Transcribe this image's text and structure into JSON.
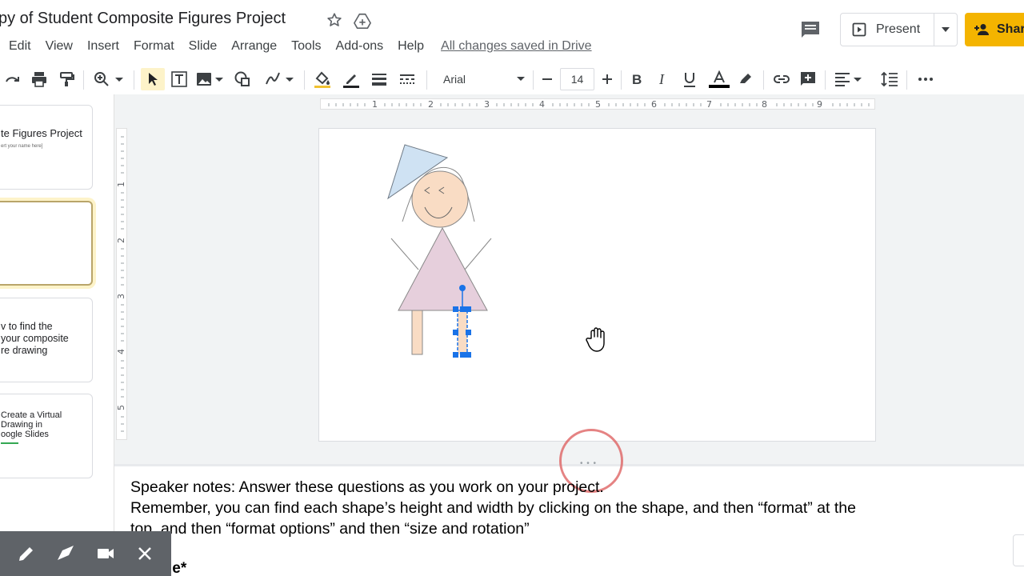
{
  "doc": {
    "title": "py of Student Composite Figures Project",
    "saved_status": "All changes saved in Drive"
  },
  "menu": [
    "Edit",
    "View",
    "Insert",
    "Format",
    "Slide",
    "Arrange",
    "Tools",
    "Add-ons",
    "Help"
  ],
  "header": {
    "present_label": "Present",
    "share_label": "Shar"
  },
  "toolbar": {
    "font_name": "Arial",
    "font_size": "14"
  },
  "ruler": {
    "horizontal": [
      "1",
      "2",
      "3",
      "4",
      "5",
      "6",
      "7",
      "8",
      "9"
    ],
    "vertical": [
      "1",
      "2",
      "3",
      "4",
      "5"
    ]
  },
  "filmstrip": {
    "slide1_title": "te Figures Project",
    "slide1_sub": "ert your name here]",
    "slide3_lines": [
      "v to find the",
      "your composite",
      "re drawing"
    ],
    "slide4_lines": [
      "Create a Virtual",
      "Drawing in",
      "oogle Slides"
    ]
  },
  "notes": {
    "line1": "Speaker notes: Answer these questions as you work on your project.",
    "line2": "Remember, you can find each shape’s height and width by clicking on the shape, and then “format” at the",
    "line3": "top, and then “format options” and then “size and rotation”",
    "bold_partial": "le*"
  },
  "colors": {
    "accent_yellow": "#f4b400",
    "selection_blue": "#1a73e8",
    "hat": "#cfe2f3",
    "skin": "#f9dcc4",
    "dress": "#e6cfdc"
  }
}
